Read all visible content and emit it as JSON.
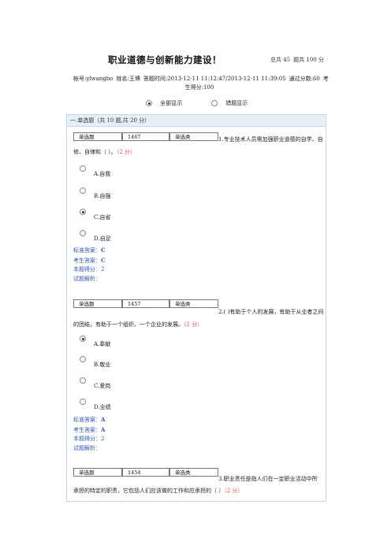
{
  "header": {
    "title": "职业道德与创新能力建设！",
    "total_score": "总共 45",
    "question_count": "题共 100 分"
  },
  "meta": {
    "account": "帐号:ylwangbo",
    "name": "姓名:王博",
    "time": "答题时间:2013-12-11 11:12:47/2013-12-11 11:39:05",
    "pass_score": "通过分数:60",
    "score_label": "考生得分:100"
  },
  "filter": {
    "show_all": "全部显示",
    "show_wrong": "错题显示",
    "selected": "show_all"
  },
  "section": {
    "title": "一.单选题（共 10 题,共 20 分）"
  },
  "questions": [
    {
      "type": "单选题",
      "id": "1467",
      "category": "单选类",
      "text_first": "1.专业技术人员需加强职业道德的自学、自",
      "text_rest": "修、自律和（ ）。",
      "points": "（2 分）",
      "options": [
        {
          "letter": "A.",
          "text": "自我",
          "checked": false
        },
        {
          "letter": "B.",
          "text": "自强",
          "checked": false
        },
        {
          "letter": "C.",
          "text": "自省",
          "checked": true
        },
        {
          "letter": "D.",
          "text": "自足",
          "checked": false
        }
      ],
      "standard_answer": "标准答案：",
      "standard_value": "C",
      "student_answer": "考生答案：",
      "student_value": "C",
      "score": "本题得分：2",
      "analysis": "试题解析："
    },
    {
      "type": "单选题",
      "id": "1457",
      "category": "单选类",
      "text_first": "2.( )有助于个人的发展，有助于从业者之间",
      "text_rest": "的团结，有助于一个组织、一个企业的发展。",
      "points": "（2 分）",
      "options": [
        {
          "letter": "A.",
          "text": "奉献",
          "checked": true
        },
        {
          "letter": "B.",
          "text": "敬业",
          "checked": false
        },
        {
          "letter": "C.",
          "text": "爱岗",
          "checked": false
        },
        {
          "letter": "D.",
          "text": "业绩",
          "checked": false
        }
      ],
      "standard_answer": "标准答案：",
      "standard_value": "A",
      "student_answer": "考生答案：",
      "student_value": "A",
      "score": "本题得分：2",
      "analysis": "试题解析："
    },
    {
      "type": "单选题",
      "id": "1454",
      "category": "单选类",
      "text_first": "3.职业责任是指人们在一定职业活动中所",
      "text_rest": "承担的特定的职责，它包括人们应该做的工作和应承担的（ ）",
      "points": "（2 分）"
    }
  ]
}
